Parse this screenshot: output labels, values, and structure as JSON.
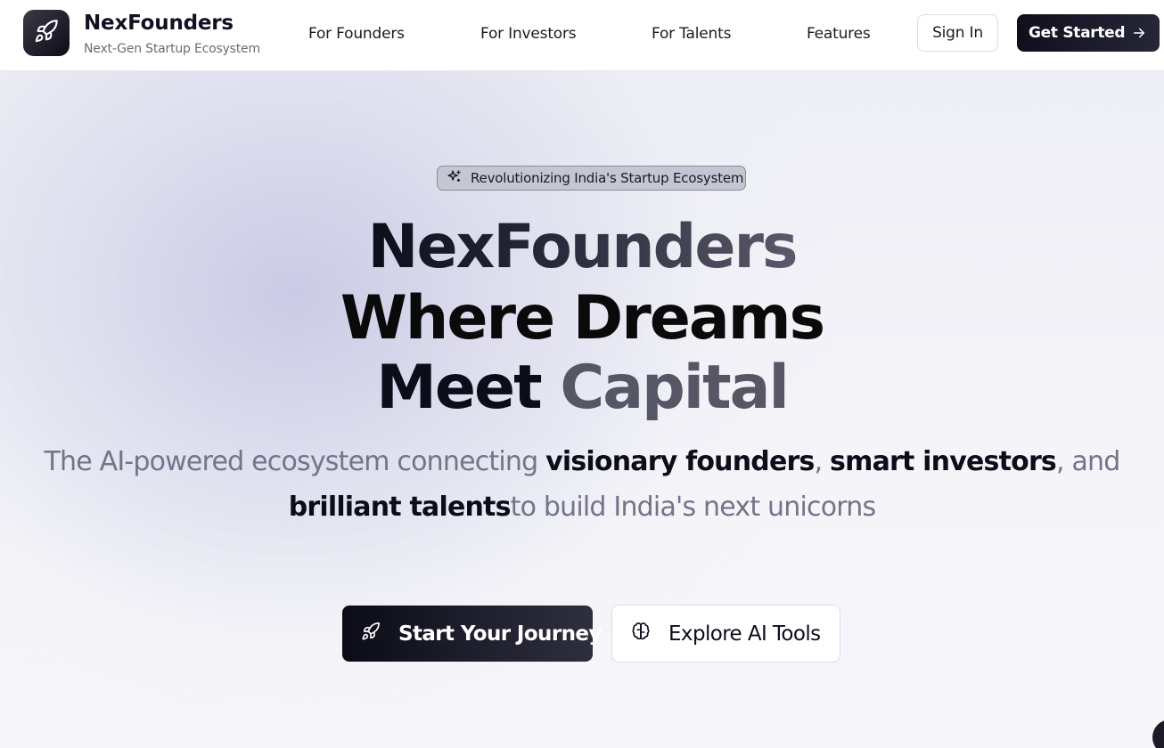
{
  "header": {
    "brand_name": "NexFounders",
    "brand_tagline": "Next-Gen Startup Ecosystem",
    "logo_icon": "rocket-icon",
    "nav": [
      {
        "label": "For Founders"
      },
      {
        "label": "For Investors"
      },
      {
        "label": "For Talents"
      },
      {
        "label": "Features"
      }
    ],
    "sign_in_label": "Sign In",
    "get_started_label": "Get Started",
    "get_started_icon": "arrow-right-icon"
  },
  "hero": {
    "badge_icon": "sparkles-icon",
    "badge_text": "Revolutionizing India's Startup Ecosystem",
    "headline_line1": "NexFounders",
    "headline_line2": "Where Dreams",
    "headline_line3_a": "Meet",
    "headline_line3_b": "Capital",
    "subtitle": {
      "p1": "The AI-powered ecosystem connecting ",
      "b1": "visionary founders",
      "p2": ", ",
      "b2": "smart investors",
      "p3": ", and",
      "b3": "brilliant talents",
      "p4": "to build India's next unicorns"
    },
    "primary_cta": {
      "label": "Start Your Journey",
      "icon": "rocket-icon"
    },
    "secondary_cta": {
      "label": "Explore AI Tools",
      "icon": "brain-icon"
    }
  },
  "colors": {
    "brand_dark": "#0d0d1a",
    "muted_text": "#73738a",
    "badge_bg": "#c6c6d2"
  }
}
